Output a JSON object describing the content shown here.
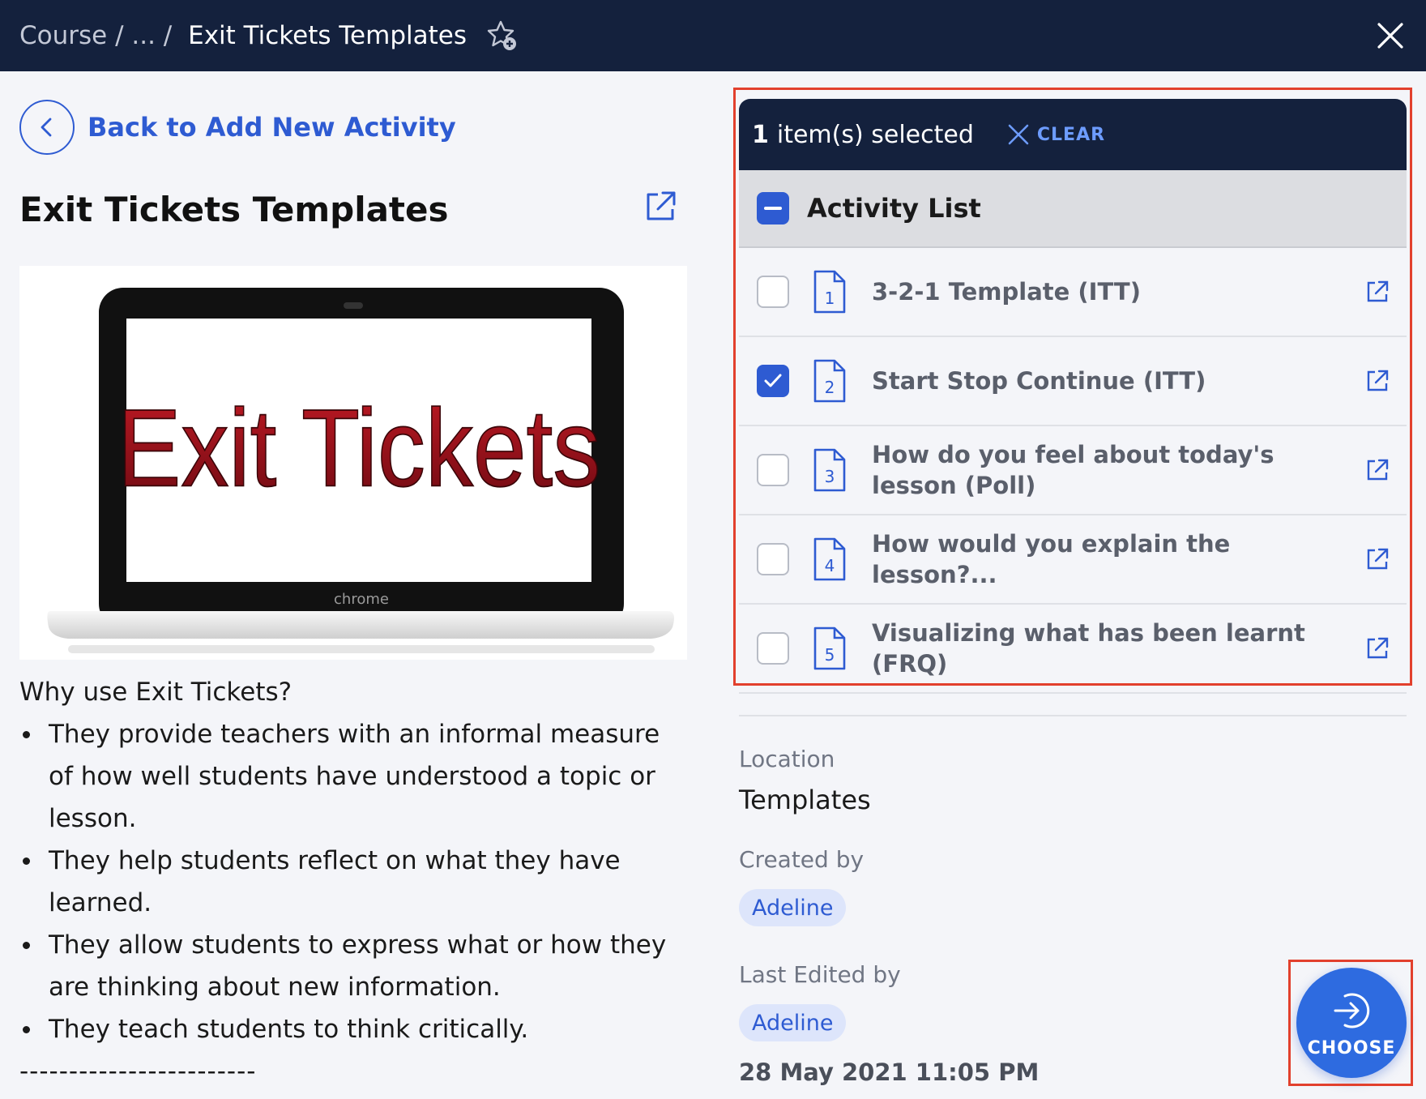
{
  "breadcrumb": {
    "root": "Course",
    "sep1": " / ",
    "ellipsis": "...",
    "sep2": " / ",
    "current": "Exit Tickets Templates"
  },
  "left": {
    "back_label": "Back to Add New Activity",
    "title": "Exit Tickets Templates",
    "hero_text": "Exit Tickets",
    "hero_brand": "chrome",
    "intro": "Why use Exit Tickets?",
    "bullets": [
      "They provide teachers with an informal measure of how well students have understood a topic or lesson.",
      "They help students reflect on what they have learned.",
      "They allow students to express what or how they are thinking about new information.",
      "They teach students to think critically."
    ],
    "dashes": "------------------------"
  },
  "selection": {
    "count": "1",
    "text": "item(s) selected",
    "clear_label": "CLEAR"
  },
  "activity_list": {
    "header": "Activity List",
    "items": [
      {
        "number": "1",
        "label": "3-2-1 Template (ITT)",
        "checked": false
      },
      {
        "number": "2",
        "label": "Start Stop Continue (ITT)",
        "checked": true
      },
      {
        "number": "3",
        "label": "How do you feel about today's lesson (Poll)",
        "checked": false
      },
      {
        "number": "4",
        "label": "How would you explain the lesson?...",
        "checked": false
      },
      {
        "number": "5",
        "label": "Visualizing what has been learnt (FRQ)",
        "checked": false
      }
    ]
  },
  "details": {
    "location_label": "Location",
    "location_value": "Templates",
    "created_label": "Created by",
    "created_value": "Adeline",
    "edited_label": "Last Edited by",
    "edited_value": "Adeline",
    "edited_date": "28 May 2021 11:05 PM"
  },
  "choose_label": "CHOOSE",
  "colors": {
    "topbar": "#14213d",
    "accent": "#2e5bd2",
    "highlight": "#e2402d",
    "hero_text": "#a8101c"
  }
}
